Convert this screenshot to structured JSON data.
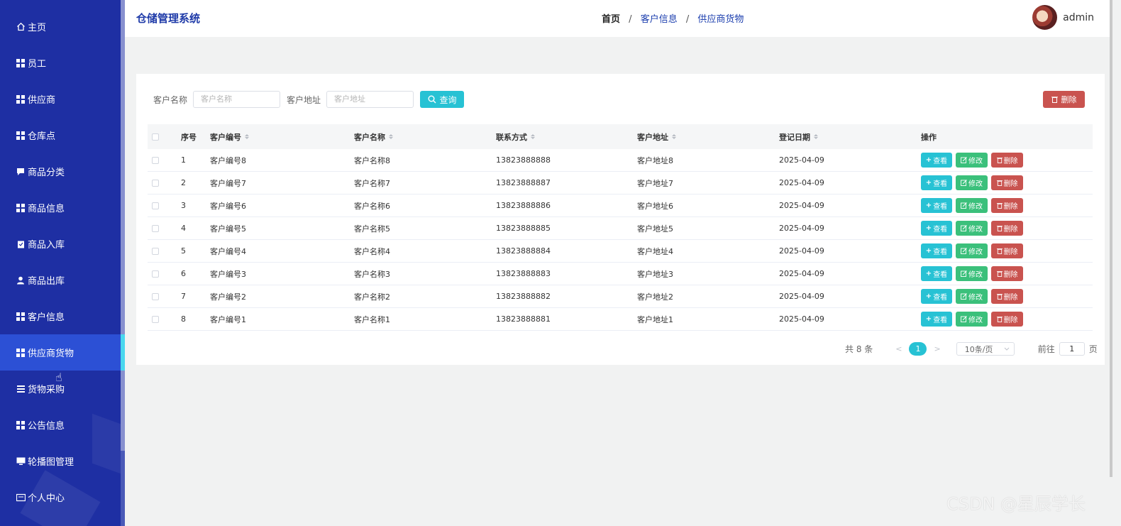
{
  "sidebar": {
    "items": [
      {
        "label": "主页",
        "icon": "home-icon"
      },
      {
        "label": "员工",
        "icon": "grid-icon"
      },
      {
        "label": "供应商",
        "icon": "grid-icon"
      },
      {
        "label": "仓库点",
        "icon": "grid-icon"
      },
      {
        "label": "商品分类",
        "icon": "comment-icon"
      },
      {
        "label": "商品信息",
        "icon": "grid-icon"
      },
      {
        "label": "商品入库",
        "icon": "clipboard-icon"
      },
      {
        "label": "商品出库",
        "icon": "user-icon"
      },
      {
        "label": "客户信息",
        "icon": "grid-icon"
      },
      {
        "label": "供应商货物",
        "icon": "grid-icon"
      },
      {
        "label": "货物采购",
        "icon": "list-icon"
      },
      {
        "label": "公告信息",
        "icon": "grid-icon"
      },
      {
        "label": "轮播图管理",
        "icon": "monitor-icon"
      },
      {
        "label": "个人中心",
        "icon": "id-card-icon"
      }
    ],
    "active_index": 9,
    "colors": {
      "background": "#1e2fa3",
      "active": "#2c50d5",
      "active_marker": "#49d7ee"
    }
  },
  "header": {
    "app_title": "仓储管理系统",
    "breadcrumb": [
      "首页",
      "客户信息",
      "供应商货物"
    ],
    "breadcrumb_separator": "/",
    "username": "admin"
  },
  "search": {
    "name_label": "客户名称",
    "name_placeholder": "客户名称",
    "address_label": "客户地址",
    "address_placeholder": "客户地址",
    "query_button": "查询",
    "delete_button": "删除"
  },
  "table": {
    "columns": [
      "序号",
      "客户编号",
      "客户名称",
      "联系方式",
      "客户地址",
      "登记日期",
      "操作"
    ],
    "rows": [
      {
        "index": "1",
        "code": "客户编号8",
        "name": "客户名称8",
        "phone": "13823888888",
        "address": "客户地址8",
        "date": "2025-04-09"
      },
      {
        "index": "2",
        "code": "客户编号7",
        "name": "客户名称7",
        "phone": "13823888887",
        "address": "客户地址7",
        "date": "2025-04-09"
      },
      {
        "index": "3",
        "code": "客户编号6",
        "name": "客户名称6",
        "phone": "13823888886",
        "address": "客户地址6",
        "date": "2025-04-09"
      },
      {
        "index": "4",
        "code": "客户编号5",
        "name": "客户名称5",
        "phone": "13823888885",
        "address": "客户地址5",
        "date": "2025-04-09"
      },
      {
        "index": "5",
        "code": "客户编号4",
        "name": "客户名称4",
        "phone": "13823888884",
        "address": "客户地址4",
        "date": "2025-04-09"
      },
      {
        "index": "6",
        "code": "客户编号3",
        "name": "客户名称3",
        "phone": "13823888883",
        "address": "客户地址3",
        "date": "2025-04-09"
      },
      {
        "index": "7",
        "code": "客户编号2",
        "name": "客户名称2",
        "phone": "13823888882",
        "address": "客户地址2",
        "date": "2025-04-09"
      },
      {
        "index": "8",
        "code": "客户编号1",
        "name": "客户名称1",
        "phone": "13823888881",
        "address": "客户地址1",
        "date": "2025-04-09"
      }
    ],
    "actions": {
      "view": "查看",
      "edit": "修改",
      "delete": "删除"
    },
    "colors": {
      "view": "#27c2d4",
      "edit": "#3bc07b",
      "delete": "#c9534f"
    }
  },
  "pagination": {
    "total": "共 8 条",
    "current_page": "1",
    "page_size": "10条/页",
    "goto_label": "前往",
    "goto_value": "1",
    "page_suffix": "页"
  },
  "watermark": "CSDN @星辰学长"
}
